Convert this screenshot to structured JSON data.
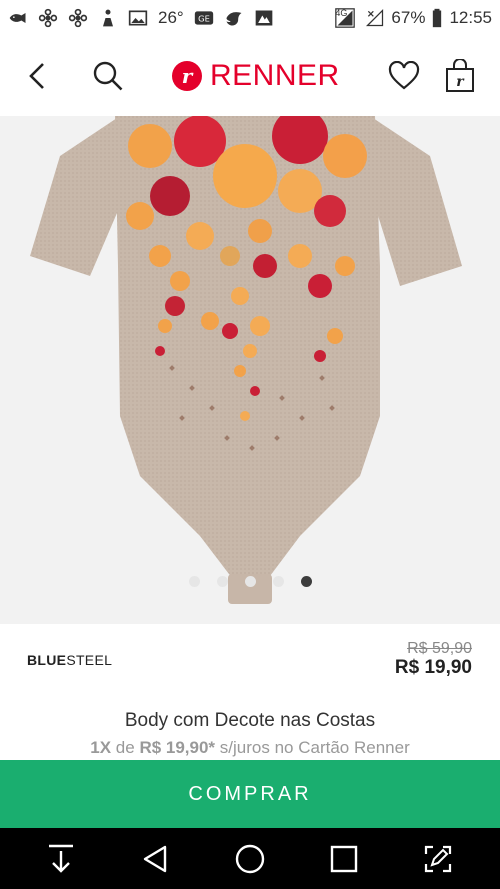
{
  "status_bar": {
    "temperature": "26°",
    "network": "4G",
    "battery": "67%",
    "time": "12:55",
    "icons": [
      "fish-icon",
      "flower-icon",
      "flower-icon",
      "person-icon",
      "image-icon",
      "ge-icon",
      "dove-icon",
      "camera-icon",
      "signal-icon",
      "no-signal-icon",
      "battery-icon"
    ]
  },
  "header": {
    "logo_text": "RENNER",
    "logo_mark": "r",
    "bag_mark": "r"
  },
  "carousel": {
    "total": 5,
    "active_index": 4
  },
  "product": {
    "brand_bold": "BLUE",
    "brand_light": "STEEL",
    "old_price": "R$ 59,90",
    "price": "R$ 19,90",
    "title": "Body com Decote nas Costas",
    "installment_count": "1X",
    "installment_de": "de",
    "installment_value": "R$ 19,90*",
    "installment_suffix": "s/juros no Cartão Renner"
  },
  "buy_button": {
    "label": "COMPRAR"
  },
  "colors": {
    "brand_red": "#e4002b",
    "buy_green": "#1aae6f"
  }
}
